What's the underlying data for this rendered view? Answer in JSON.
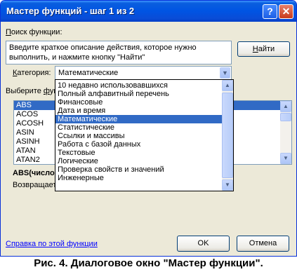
{
  "window": {
    "title": "Мастер функций - шаг 1 из 2"
  },
  "search": {
    "label_u": "П",
    "label_rest": "оиск функции:",
    "description": "Введите краткое описание действия, которое нужно выполнить, и нажмите кнопку \"Найти\"",
    "find_u": "Н",
    "find_rest": "айти"
  },
  "category": {
    "label_u": "К",
    "label_rest": "атегория:",
    "value": "Математические",
    "options": [
      "10 недавно использовавшихся",
      "Полный алфавитный перечень",
      "Финансовые",
      "Дата и время",
      "Математические",
      "Статистические",
      "Ссылки и массивы",
      "Работа с базой данных",
      "Текстовые",
      "Логические",
      "Проверка свойств и значений",
      "Инженерные"
    ],
    "selected_index": 4
  },
  "functions": {
    "label_a": "Выберите ",
    "label_u": "ф",
    "label_b": "ун",
    "items": [
      "ABS",
      "ACOS",
      "ACOSH",
      "ASIN",
      "ASINH",
      "ATAN",
      "ATAN2"
    ],
    "selected_index": 0
  },
  "info": {
    "signature": "ABS(число",
    "description": "Возвращает"
  },
  "footer": {
    "help_link": "Справка по этой функции",
    "ok": "OK",
    "cancel": "Отмена"
  },
  "caption": "Рис. 4. Диалоговое окно \"Мастер функции\"."
}
